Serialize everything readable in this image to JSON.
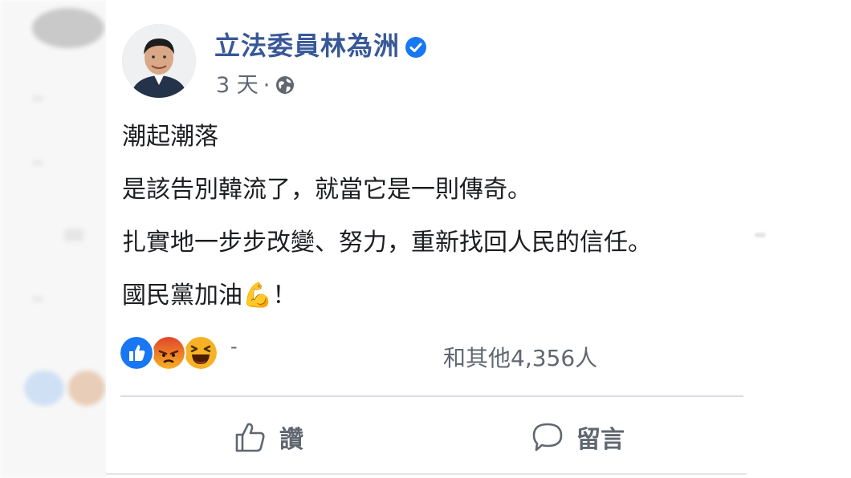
{
  "post": {
    "author": "立法委員林為洲",
    "time": "3 天",
    "separator": "·",
    "lines": [
      "潮起潮落",
      "是該告別韓流了，就當它是一則傳奇。",
      "扎實地一步步改變、努力，重新找回人民的信任。",
      "國民黨加油💪！"
    ],
    "reactions": {
      "icons": [
        "like-icon",
        "angry-icon",
        "haha-icon"
      ],
      "summary": "和其他4,356人",
      "dash": "-"
    },
    "actions": {
      "like_label": "讚",
      "comment_label": "留言"
    }
  },
  "colors": {
    "author": "#385898",
    "verified": "#1877f2",
    "like": "#1877f2",
    "angry": "#e9710f",
    "haha": "#f7b125",
    "secondary_text": "#606770"
  }
}
